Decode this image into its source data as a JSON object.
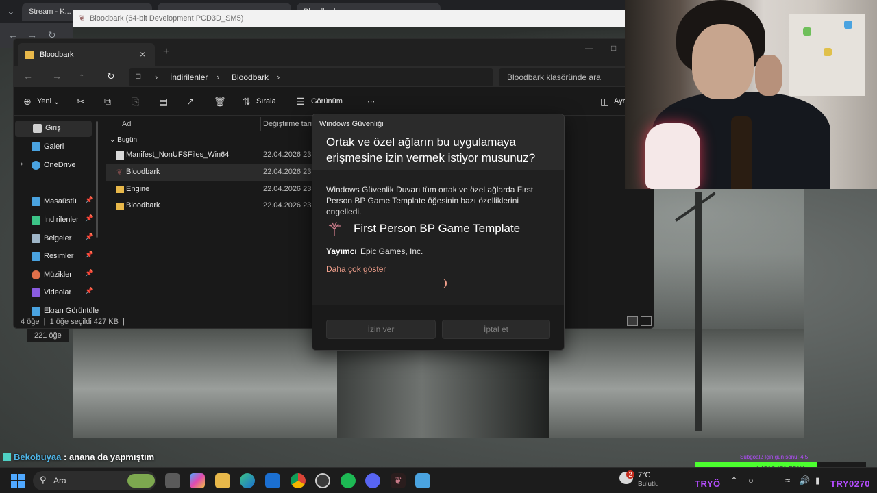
{
  "browser": {
    "tabs": [
      "Stream - K...",
      "...",
      "Bloodbark..."
    ],
    "game_window_title": "Bloodbark (64-bit Development PCD3D_SM5)"
  },
  "explorer": {
    "tab_title": "Bloodbark",
    "address": {
      "path": [
        "İndirilenler",
        "Bloodbark"
      ],
      "search_placeholder": "Bloodbark klasöründe ara"
    },
    "toolbar": {
      "new_label": "Yeni",
      "sort_label": "Sırala",
      "view_label": "Görünüm",
      "more_label": "⋯",
      "details_label": "Ayr"
    },
    "sidebar": {
      "items": [
        {
          "label": "Giriş",
          "icon": "home-icon",
          "color": "#e6e6e6"
        },
        {
          "label": "Galeri",
          "icon": "gallery-icon",
          "color": "#4aa3e0"
        },
        {
          "label": "OneDrive",
          "icon": "cloud-icon",
          "color": "#4aa3e0"
        }
      ],
      "pinned": [
        {
          "label": "Masaüstü",
          "icon": "desktop-icon",
          "color": "#4aa3e0"
        },
        {
          "label": "İndirilenler",
          "icon": "download-icon",
          "color": "#3cc487"
        },
        {
          "label": "Belgeler",
          "icon": "documents-icon",
          "color": "#9fb6c8"
        },
        {
          "label": "Resimler",
          "icon": "pictures-icon",
          "color": "#4aa3e0"
        },
        {
          "label": "Müzikler",
          "icon": "music-icon",
          "color": "#e0704a"
        },
        {
          "label": "Videolar",
          "icon": "videos-icon",
          "color": "#8a5ce0"
        },
        {
          "label": "Ekran Görüntüle",
          "icon": "screenshots-icon",
          "color": "#4aa3e0"
        }
      ]
    },
    "columns": {
      "name": "Ad",
      "date": "Değiştirme tarihi"
    },
    "group": "Bugün",
    "files": [
      {
        "name": "Manifest_NonUFSFiles_Win64",
        "date": "22.04.2026 23:23",
        "type": "file"
      },
      {
        "name": "Bloodbark",
        "date": "22.04.2026 23:23",
        "type": "app"
      },
      {
        "name": "Engine",
        "date": "22.04.2026 23:23",
        "type": "folder"
      },
      {
        "name": "Bloodbark",
        "date": "22.04.2026 23:23",
        "type": "folder"
      }
    ],
    "status": {
      "count": "4 öğe",
      "selected": "1 öğe seçildi  427 KB"
    },
    "behind_status": "221 öğe"
  },
  "dialog": {
    "title": "Windows Güvenliği",
    "heading": "Ortak ve özel ağların bu uygulamaya erişmesine izin vermek istiyor musunuz?",
    "body": "Windows Güvenlik Duvarı tüm ortak ve özel ağlarda First Person BP Game Template öğesinin bazı özelliklerini engelledi.",
    "app_name": "First Person BP Game Template",
    "publisher_label": "Yayımcı",
    "publisher_value": "Epic Games, Inc.",
    "more_link": "Daha çok göster",
    "allow_button": "İzin ver",
    "cancel_button": "İptal et",
    "accent": "#f2a08c"
  },
  "chat": {
    "user": "Bekobuyaa",
    "message": ": anana da yapmıştım"
  },
  "goal": {
    "title": "Subgoal2 Için gün sonu: 4.5",
    "label": "14316 (71.55%)",
    "progress_percent": 71.55,
    "color": "#4cff2f"
  },
  "taskbar": {
    "search_placeholder": "Ara",
    "weather": {
      "temp": "7°C",
      "condition": "Bulutlu",
      "badge": "2"
    },
    "overlay_left": "TRYÖ",
    "overlay_right": "TRY0270"
  }
}
